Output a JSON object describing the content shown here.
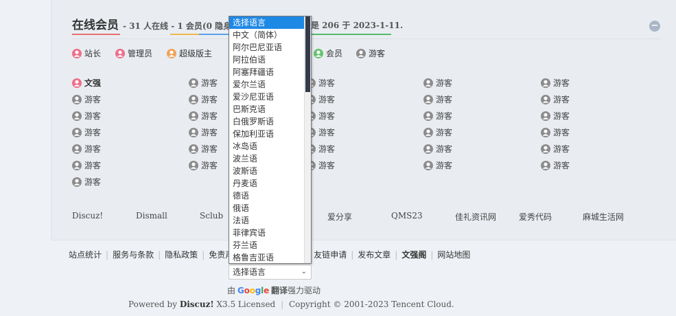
{
  "online": {
    "title": "在线会员",
    "summary": "- 31 人在线 - 1 会员(0 隐身)",
    "record": "是 206 于 2023-1-11.",
    "collapse_symbol": "−"
  },
  "colors": {
    "admin": "#ef6f8a",
    "manager": "#ef6f8a",
    "supermod": "#f0a35a",
    "member": "#67c26f",
    "guest": "#8c8c8c",
    "title_red": "#e86f6f",
    "title_yellow": "#f2b84b",
    "title_blue": "#5aa0e6",
    "title_green": "#55b86a",
    "selected_blue": "#1e88e5"
  },
  "legend": {
    "admin": "站长",
    "manager": "管理员",
    "supermod": "超级版主",
    "member": "会员",
    "guest": "游客"
  },
  "users": {
    "first": "文强",
    "guest": "游客"
  },
  "links": [
    "Discuz!",
    "Dismall",
    "Sclub",
    "爱分享",
    "QMS23",
    "佳礼资讯网",
    "爱秀代码",
    "麻城生活网"
  ],
  "footer": {
    "nav": [
      "站点统计",
      "服务与条款",
      "隐私政策",
      "免责声",
      "友链申请",
      "发布文章",
      "文强阁",
      "网站地图"
    ],
    "select_value": "选择语言",
    "google_prefix": "由",
    "google_logo": "Google",
    "google_translate": "翻译",
    "google_suffix": "强力驱动",
    "powered_by": "Powered by",
    "brand": "Discuz!",
    "version": "X3.5 Licensed",
    "copyright": "Copyright © 2001-2023 Tencent Cloud."
  },
  "language_dropdown": {
    "options": [
      "选择语言",
      "中文（简体）",
      "阿尔巴尼亚语",
      "阿拉伯语",
      "阿塞拜疆语",
      "爱尔兰语",
      "爱沙尼亚语",
      "巴斯克语",
      "白俄罗斯语",
      "保加利亚语",
      "冰岛语",
      "波兰语",
      "波斯语",
      "丹麦语",
      "德语",
      "俄语",
      "法语",
      "菲律宾语",
      "芬兰语",
      "格鲁吉亚语"
    ],
    "selected_index": 0
  }
}
